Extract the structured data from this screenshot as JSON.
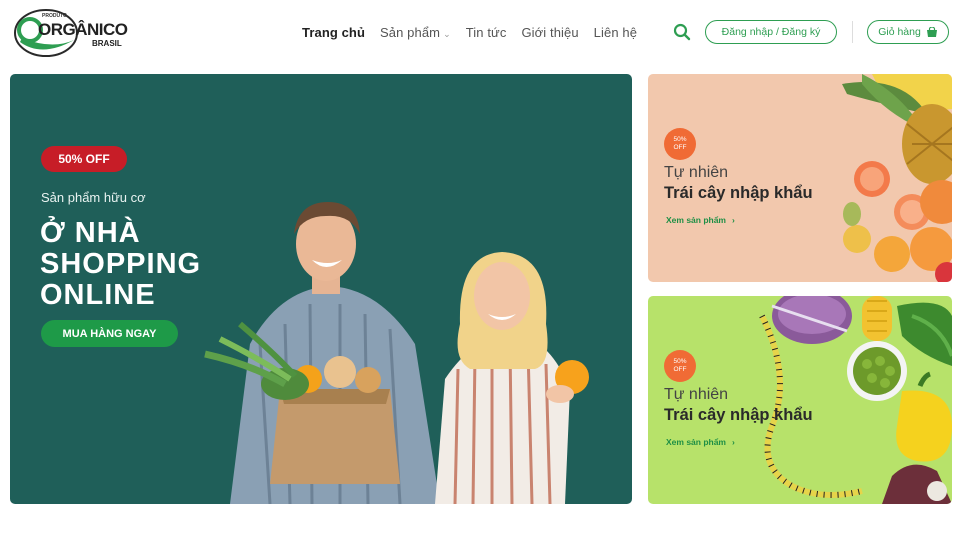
{
  "brand": {
    "logo_small": "PRODUTO",
    "logo_main": "ORGÂNICO",
    "logo_sub": "BRASIL"
  },
  "nav": {
    "items": [
      {
        "label": "Trang chủ",
        "active": true
      },
      {
        "label": "Sản phẩm",
        "has_dropdown": true
      },
      {
        "label": "Tin tức"
      },
      {
        "label": "Giới thiệu"
      },
      {
        "label": "Liên hệ"
      }
    ],
    "search_icon": "search-icon",
    "login_label": "Đăng nhập / Đăng ký",
    "cart_label": "Giỏ hàng",
    "cart_icon": "cart-icon"
  },
  "hero": {
    "badge": "50% OFF",
    "subtitle": "Sản phẩm hữu cơ",
    "title_lines": [
      "Ở NHÀ",
      "SHOPPING",
      "ONLINE"
    ],
    "cta": "MUA HÀNG NGAY",
    "bg_color": "#1f5f59"
  },
  "side_banners": [
    {
      "badge_line1": "50%",
      "badge_line2": "OFF",
      "kicker": "Tự nhiên",
      "title": "Trái cây nhập khẩu",
      "link": "Xem sản phẩm",
      "bg_color": "#f2c8ad"
    },
    {
      "badge_line1": "50%",
      "badge_line2": "OFF",
      "kicker": "Tự nhiên",
      "title": "Trái cây nhập khẩu",
      "link": "Xem sản phẩm",
      "bg_color": "#b7e26a"
    }
  ],
  "colors": {
    "accent": "#2e9e52",
    "badge_red": "#c71d27",
    "badge_orange": "#f06b35"
  }
}
